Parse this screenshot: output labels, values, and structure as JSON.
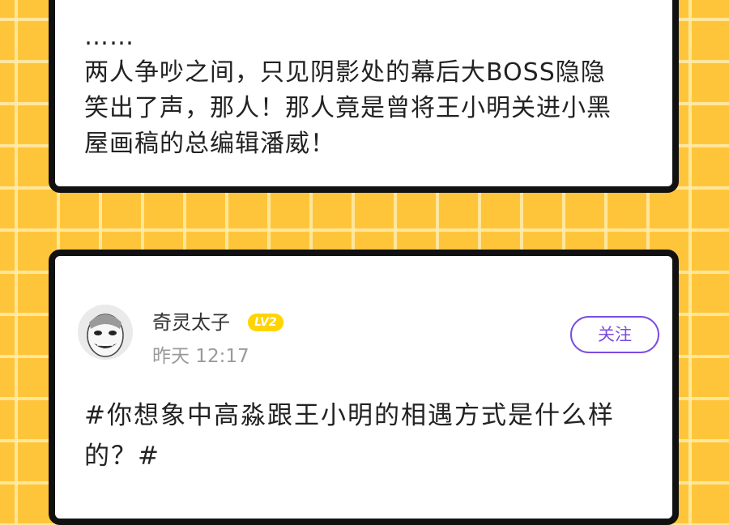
{
  "top_post": {
    "text": "……\n两人争吵之间，只见阴影处的幕后大BOSS隐隐\n笑出了声，那人！那人竟是曾将王小明关进小黑\n屋画稿的总编辑潘威！"
  },
  "bottom_post": {
    "user": {
      "name": "奇灵太子",
      "level": "LV2",
      "time": "昨天 12:17",
      "avatar": "avatar-icon"
    },
    "follow_label": "关注",
    "text": "#你想象中高淼跟王小明的相遇方式是什么样\n的？#"
  },
  "colors": {
    "background": "#FFC53A",
    "grid_line": "#FFECAA",
    "card_border": "#111111",
    "follow_accent": "#7B4DE0",
    "level_badge": "#FFD400"
  }
}
